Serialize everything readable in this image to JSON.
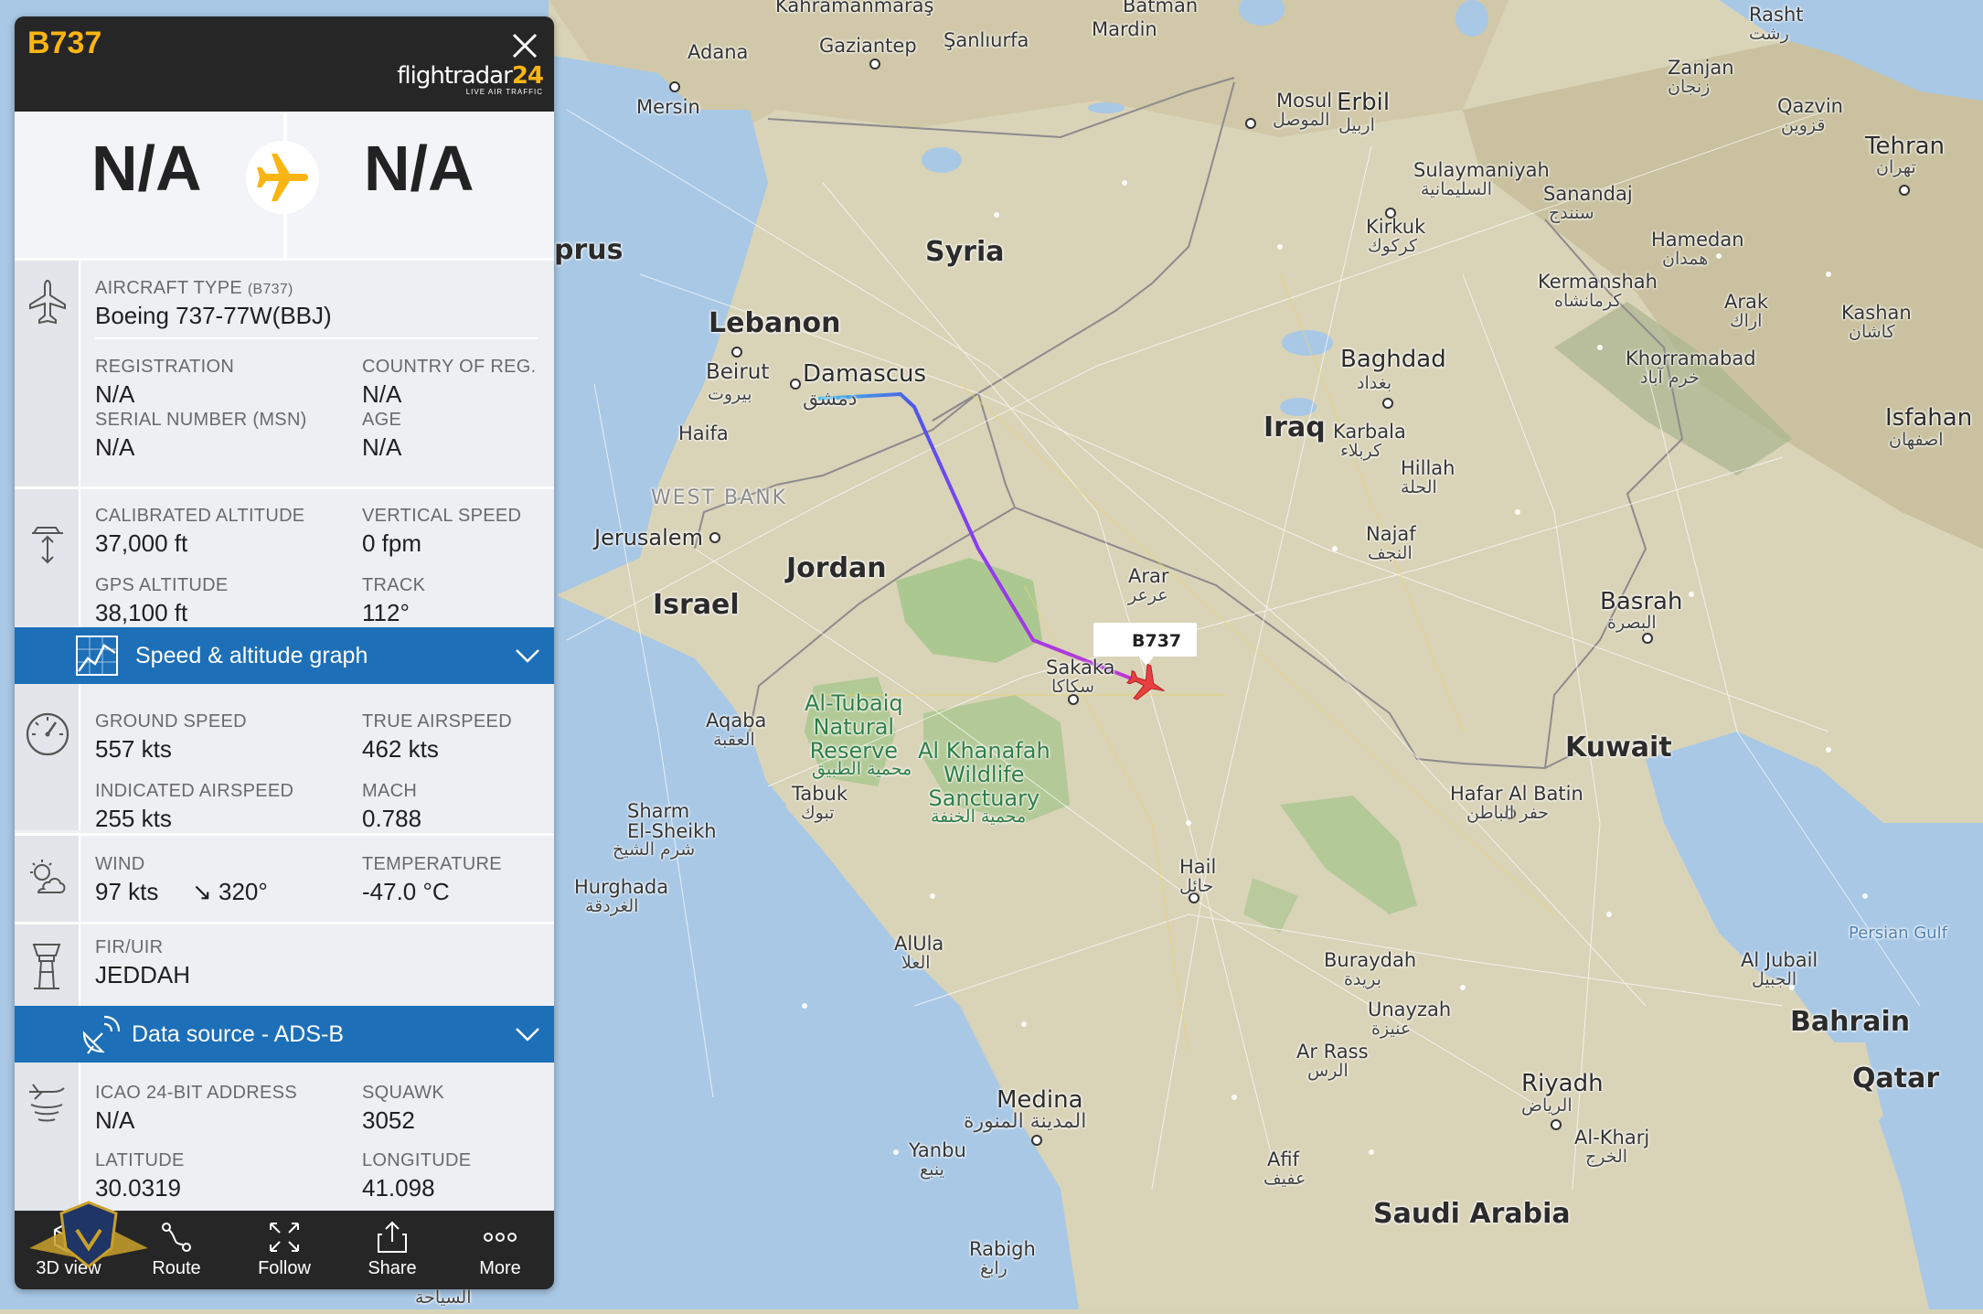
{
  "panel": {
    "callsign": "B737",
    "logo": {
      "brand": "flightradar",
      "brand_num": "24",
      "tagline": "LIVE AIR TRAFFIC"
    },
    "origin": "N/A",
    "destination": "N/A",
    "aircraft": {
      "type_label": "AIRCRAFT TYPE",
      "type_code": "(B737)",
      "type_value": "Boeing 737-77W(BBJ)",
      "registration_label": "REGISTRATION",
      "registration_value": "N/A",
      "country_label": "COUNTRY OF REG.",
      "country_value": "N/A",
      "serial_label": "SERIAL NUMBER (MSN)",
      "serial_value": "N/A",
      "age_label": "AGE",
      "age_value": "N/A"
    },
    "altitude": {
      "cal_alt_label": "CALIBRATED ALTITUDE",
      "cal_alt_value": "37,000 ft",
      "vs_label": "VERTICAL SPEED",
      "vs_value": "0 fpm",
      "gps_alt_label": "GPS ALTITUDE",
      "gps_alt_value": "38,100 ft",
      "track_label": "TRACK",
      "track_value": "112°"
    },
    "speed_graph_label": "Speed & altitude graph",
    "speed": {
      "gs_label": "GROUND SPEED",
      "gs_value": "557 kts",
      "tas_label": "TRUE AIRSPEED",
      "tas_value": "462 kts",
      "ias_label": "INDICATED AIRSPEED",
      "ias_value": "255 kts",
      "mach_label": "MACH",
      "mach_value": "0.788"
    },
    "weather": {
      "wind_label": "WIND",
      "wind_speed": "97 kts",
      "wind_dir": "↘ 320°",
      "temp_label": "TEMPERATURE",
      "temp_value": "-47.0 °C"
    },
    "fir": {
      "label": "FIR/UIR",
      "value": "JEDDAH"
    },
    "data_source_label": "Data source - ADS-B",
    "source": {
      "icao_label": "ICAO 24-BIT ADDRESS",
      "icao_value": "N/A",
      "squawk_label": "SQUAWK",
      "squawk_value": "3052",
      "lat_label": "LATITUDE",
      "lat_value": "30.0319",
      "lon_label": "LONGITUDE",
      "lon_value": "41.098"
    },
    "toolbar": [
      "3D view",
      "Route",
      "Follow",
      "Share",
      "More"
    ]
  },
  "map": {
    "aircraft_tag": "B737",
    "countries": [
      "Syria",
      "Lebanon",
      "Jordan",
      "Israel",
      "Iraq",
      "Kuwait",
      "Bahrain",
      "Qatar",
      "Saudi Arabia",
      "prus"
    ],
    "region_label": "WEST BANK",
    "water_label": "Persian Gulf",
    "cities": {
      "adana": "Adana",
      "gaziantep": "Gaziantep",
      "sanliurfa": "Şanlıurfa",
      "mardin": "Mardin",
      "batman": "Batman",
      "kahramanmaras": "Kahramanmaraş",
      "mersin": "Mersin",
      "rasht": "Rasht",
      "rasht_ar": "رشت",
      "zanjan": "Zanjan",
      "zanjan_ar": "زنجان",
      "qazvin": "Qazvin",
      "qazvin_ar": "قزوين",
      "tehran": "Tehran",
      "tehran_ar": "تهران",
      "mosul": "Mosul",
      "mosul_ar": "الموصل",
      "erbil": "Erbil",
      "erbil_ar": "اربيل",
      "sulaymaniyah": "Sulaymaniyah",
      "sulaymaniyah_ar": "السليمانية",
      "sanandaj": "Sanandaj",
      "sanandaj_ar": "سنندج",
      "hamedan": "Hamedan",
      "hamedan_ar": "همدان",
      "kirkuk": "Kirkuk",
      "kirkuk_ar": "كركوك",
      "kermanshah": "Kermanshah",
      "kermanshah_ar": "كرمانشاه",
      "arak": "Arak",
      "arak_ar": "اراك",
      "kashan": "Kashan",
      "kashan_ar": "كاشان",
      "khorramabad": "Khorramabad",
      "khorramabad_ar": "خرم آباد",
      "baghdad": "Baghdad",
      "baghdad_ar": "بغداد",
      "isfahan": "Isfahan",
      "isfahan_ar": "اصفهان",
      "beirut": "Beirut",
      "beirut_ar": "بيروت",
      "damascus": "Damascus",
      "damascus_ar": "دمشق",
      "haifa": "Haifa",
      "karbala": "Karbala",
      "karbala_ar": "كربلاء",
      "hillah": "Hillah",
      "hillah_ar": "الحلة",
      "jerusalem": "Jerusalem",
      "najaf": "Najaf",
      "najaf_ar": "النجف",
      "arar": "Arar",
      "arar_ar": "عرعر",
      "basrah": "Basrah",
      "basrah_ar": "البصرة",
      "sakaka": "Sakaka",
      "sakaka_ar": "سكاكا",
      "aqaba": "Aqaba",
      "aqaba_ar": "العقبة",
      "tabuk": "Tabuk",
      "tabuk_ar": "تبوك",
      "hafar": "Hafar Al Batin",
      "hafar_ar": "حفر الباطن",
      "sharm": "Sharm\nEl-Sheikh",
      "sharm_ar": "شرم الشيخ",
      "hail": "Hail",
      "hail_ar": "حائل",
      "hurghada": "Hurghada",
      "hurghada_ar": "الغردقة",
      "alula": "AlUla",
      "alula_ar": "العلا",
      "buraydah": "Buraydah",
      "buraydah_ar": "بريدة",
      "unayzah": "Unayzah",
      "unayzah_ar": "عنيزة",
      "ajubail": "Al Jubail",
      "ajubail_ar": "الجبيل",
      "arrass": "Ar Rass",
      "arrass_ar": "الرس",
      "riyadh": "Riyadh",
      "riyadh_ar": "الرياض",
      "medina": "Medina",
      "medina_ar": "المدينة المنورة",
      "alkharj": "Al-Kharj",
      "alkharj_ar": "الخرج",
      "yanbu": "Yanbu",
      "yanbu_ar": "ينبع",
      "afif": "Afif",
      "afif_ar": "عفيف",
      "rabigh": "Rabigh",
      "rabigh_ar": "رابغ",
      "ssahil": "السياحة"
    },
    "parks": {
      "tubaiq": "Al-Tubaiq\nNatural\nReserve",
      "tubaiq_ar": "محمية الطبيق",
      "khanafah": "Al Khanafah\nWildlife\nSanctuary",
      "khanafah_ar": "محمية الخنفة"
    },
    "colors": {
      "track_start": "#48c4e8",
      "track_mid": "#6a3cf0",
      "track_end": "#b13ad6",
      "aircraft": "#e64040",
      "accent": "#fbb513",
      "bar": "#1d6fb8"
    }
  }
}
